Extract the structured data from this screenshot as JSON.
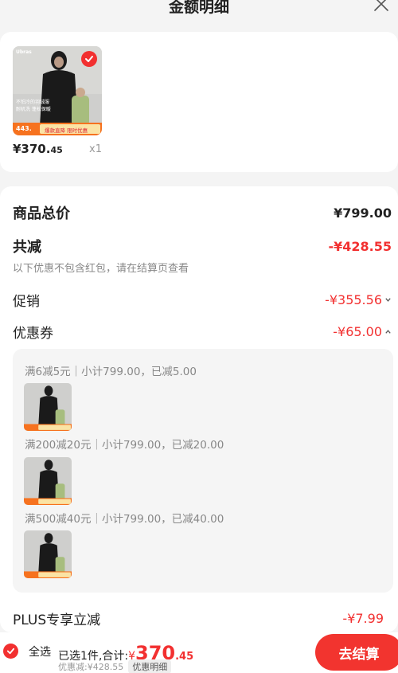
{
  "header": {
    "title": "金额明细"
  },
  "product": {
    "price_int": "¥370.",
    "price_dec": "45",
    "qty": "x1",
    "image_texts": {
      "brand": "Ubras",
      "slogan1": "不怕冷的羽绒服",
      "slogan2": "耐机洗 蓬松保暖",
      "tag_price": "443.",
      "tag_promo": "爆款直降 限时优惠"
    }
  },
  "summary": {
    "total_label": "商品总价",
    "total_value": "¥799.00",
    "reduce_label": "共减",
    "reduce_value": "-¥428.55",
    "note": "以下优惠不包含红包，请在结算页查看",
    "promo_label": "促销",
    "promo_value": "-¥355.56",
    "coupon_label": "优惠券",
    "coupon_value": "-¥65.00",
    "plus_label": "PLUS专享立减",
    "plus_value": "-¥7.99"
  },
  "coupons": [
    {
      "text": "满6减5元｜小计799.00，已减5.00"
    },
    {
      "text": "满200减20元｜小计799.00，已减20.00"
    },
    {
      "text": "满500减40元｜小计799.00，已减40.00"
    }
  ],
  "bottom": {
    "select_all": "全选",
    "selected": "已选1件,合计:",
    "total_yen": "¥",
    "total_int": "370",
    "total_dec": ".45",
    "discount_text": "优惠减:¥428.55",
    "detail_btn": "优惠明细",
    "checkout": "去结算"
  },
  "colors": {
    "accent": "#f23030",
    "bg": "#f4f4f4"
  }
}
